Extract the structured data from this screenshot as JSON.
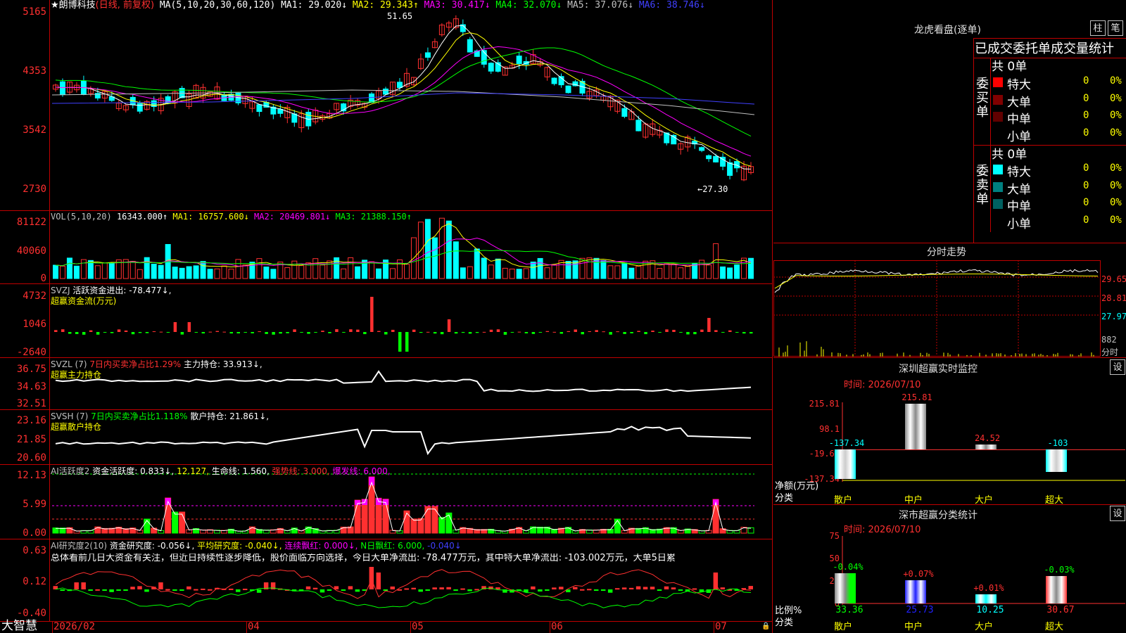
{
  "app": {
    "logo": "大智慧"
  },
  "main": {
    "title": "★朗博科技",
    "mode": "(日线, 前复权)",
    "ma_header": "MA(5,10,20,30,60,120)",
    "ma_items": [
      {
        "label": "MA1: 29.020↓",
        "color": "#ffffff"
      },
      {
        "label": "MA2: 29.343↑",
        "color": "#ffff00"
      },
      {
        "label": "MA3: 30.417↓",
        "color": "#ff00ff"
      },
      {
        "label": "MA4: 32.070↓",
        "color": "#00ff00"
      },
      {
        "label": "MA5: 37.076↓",
        "color": "#c0c0c0"
      },
      {
        "label": "MA6: 38.746↓",
        "color": "#4040ff"
      }
    ],
    "y_ticks": [
      "5165",
      "4353",
      "3542",
      "2730"
    ],
    "high_label": "51.65",
    "low_label": "←27.30"
  },
  "vol": {
    "header": "VOL(5,10,20)",
    "value": "16343.000↑",
    "ma1": "MA1: 16757.600↓",
    "ma2": "MA2: 20469.801↓",
    "ma3": "MA3: 21388.150↑",
    "y_ticks": [
      "81122",
      "40060",
      "0"
    ]
  },
  "svzj": {
    "header": "SVZJ",
    "text": "活跃资金进出: -78.477↓,",
    "sub": "超赢资金流(万元)",
    "y_ticks": [
      "4732",
      "1046",
      "-2640"
    ]
  },
  "svzl": {
    "header": "SVZL (7)",
    "text1": "7日内买卖净占比1.29%",
    "text2": "主力持仓: 33.913↓,",
    "sub": "超赢主力持仓",
    "y_ticks": [
      "36.75",
      "34.63",
      "32.51"
    ]
  },
  "svsh": {
    "header": "SVSH (7)",
    "text1": "7日内买卖净占比1.118%",
    "text2": "散户持仓: 21.861↓,",
    "sub": "超赢散户持仓",
    "y_ticks": [
      "23.16",
      "21.85",
      "20.60"
    ]
  },
  "ai1": {
    "header": "AI活跃度2",
    "t1": "资金活跃度: 0.833↓,",
    "t2": "12.127,",
    "t3": "生命线: 1.560,",
    "t4": "强势线: 3.000,",
    "t5": "爆发线: 6.000,",
    "y_ticks": [
      "12.13",
      "5.99",
      "0.00"
    ]
  },
  "ai2": {
    "header": "AI研究度2(10)",
    "t1": "资金研究度: -0.056↓,",
    "t2": "平均研究度: -0.040↓,",
    "t3": "连续飘红: 0.000↓,",
    "t4": "N日飘红: 6.000,",
    "t5": "-0.040↓",
    "summary": "总体看前几日大资金有关注，但近日持续性逐步降低，股价面临方向选择，今日大单净流出: -78.477万元，其中特大单净流出: -103.002万元，大单5日累",
    "y_ticks": [
      "0.63",
      "0.12",
      "-0.40"
    ]
  },
  "xaxis": [
    "2026/02",
    "04",
    "05",
    "06",
    "07"
  ],
  "dragon": {
    "title": "龙虎看盘(逐单)",
    "btn1": "柱",
    "btn2": "笔",
    "header": "已成交委托单成交量统计",
    "buy": {
      "side": "委买单",
      "total": "共 0单",
      "rows": [
        {
          "name": "特大",
          "count": "0",
          "pct": "0%",
          "color": "#ff0000"
        },
        {
          "name": "大单",
          "count": "0",
          "pct": "0%",
          "color": "#800000"
        },
        {
          "name": "中单",
          "count": "0",
          "pct": "0%",
          "color": "#600000"
        },
        {
          "name": "小单",
          "count": "0",
          "pct": "0%",
          "color": "#000000"
        }
      ]
    },
    "sell": {
      "side": "委卖单",
      "total": "共 0单",
      "rows": [
        {
          "name": "特大",
          "count": "0",
          "pct": "0%",
          "color": "#00ffff"
        },
        {
          "name": "大单",
          "count": "0",
          "pct": "0%",
          "color": "#008080"
        },
        {
          "name": "中单",
          "count": "0",
          "pct": "0%",
          "color": "#006060"
        },
        {
          "name": "小单",
          "count": "0",
          "pct": "0%",
          "color": "#000000"
        }
      ]
    }
  },
  "intraday": {
    "title": "分时走势",
    "y_ticks": [
      "29.65",
      "28.81",
      "27.97",
      "882",
      "分时"
    ]
  },
  "shenzhen_monitor": {
    "title": "深圳超赢实时监控",
    "settings": "设",
    "time": "时间: 2026/07/10",
    "y_ticks": [
      "215.81",
      "98.1",
      "-19.62",
      "-137.34"
    ],
    "ylabel": "净额(万元)",
    "xlabel": "分类",
    "categories": [
      "散户",
      "中户",
      "大户",
      "超大"
    ],
    "values": [
      -137.34,
      215.81,
      24.52,
      -103
    ],
    "value_labels": [
      "-137.34",
      "215.81",
      "24.52",
      "-103"
    ]
  },
  "shenzhen_stats": {
    "title": "深市超赢分类统计",
    "settings": "设",
    "time": "时间: 2026/07/10",
    "y_ticks": [
      "75",
      "50",
      "25",
      "0"
    ],
    "ylabel": "比例%",
    "xlabel": "分类",
    "categories": [
      "散户",
      "中户",
      "大户",
      "超大"
    ],
    "values": [
      33.36,
      25.73,
      10.25,
      30.67
    ],
    "value_labels": [
      "33.36",
      "25.73",
      "10.25",
      "30.67"
    ],
    "changes": [
      "-0.04%",
      "+0.07%",
      "+0.01%",
      "-0.03%"
    ]
  }
}
